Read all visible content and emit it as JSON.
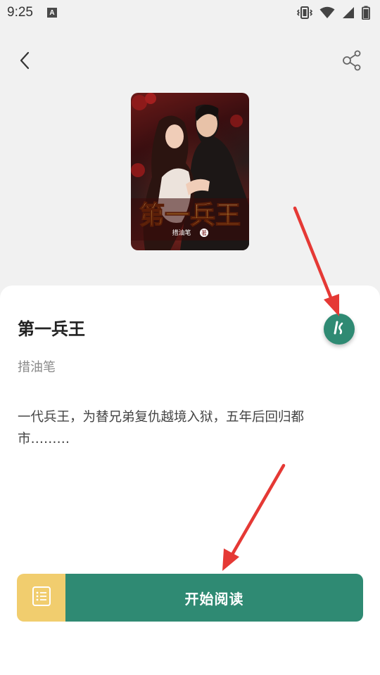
{
  "status_bar": {
    "time": "9:25",
    "badge": "A",
    "icons": [
      "vibrate-icon",
      "wifi-icon",
      "signal-icon",
      "battery-icon"
    ]
  },
  "header": {
    "back_icon": "chevron-left-icon",
    "share_icon": "share-icon"
  },
  "book": {
    "cover_title": "第一兵王",
    "cover_author": "措油笔",
    "cover_author_suffix": "著",
    "title": "第一兵王",
    "author": "措油笔",
    "description": "一代兵王，为替兄弟复仇越境入狱，五年后回归都市………"
  },
  "fab": {
    "icon": "listen-icon"
  },
  "actions": {
    "catalog_icon": "catalog-list-icon",
    "read_label": "开始阅读"
  },
  "colors": {
    "accent": "#2f8a73",
    "catalog": "#f1cd6e",
    "annotation": "#e53935",
    "background": "#f1f1f1"
  }
}
